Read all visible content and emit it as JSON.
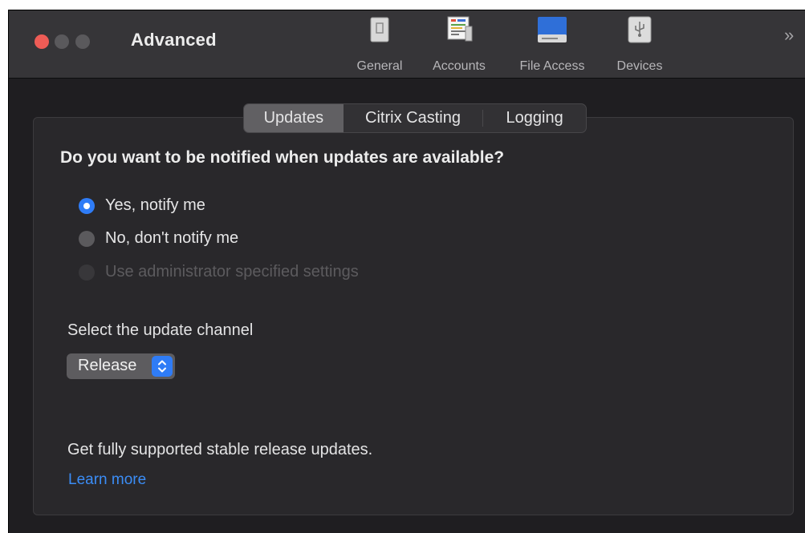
{
  "window": {
    "title": "Advanced",
    "overflow_glyph": "»"
  },
  "toolbar": {
    "items": [
      {
        "label": "General",
        "icon": "general-icon"
      },
      {
        "label": "Accounts",
        "icon": "accounts-icon"
      },
      {
        "label": "File Access",
        "icon": "file-access-icon"
      },
      {
        "label": "Devices",
        "icon": "devices-icon"
      }
    ]
  },
  "tabs": [
    {
      "label": "Updates",
      "selected": true
    },
    {
      "label": "Citrix Casting",
      "selected": false
    },
    {
      "label": "Logging",
      "selected": false
    }
  ],
  "updates": {
    "question": "Do you want to be notified when updates are available?",
    "options": [
      {
        "label": "Yes, notify me",
        "selected": true,
        "enabled": true
      },
      {
        "label": "No, don't notify me",
        "selected": false,
        "enabled": true
      },
      {
        "label": "Use administrator specified settings",
        "selected": false,
        "enabled": false
      }
    ],
    "channel_label": "Select the update channel",
    "channel_value": "Release",
    "description": "Get fully supported stable release updates.",
    "learn_more": "Learn more"
  },
  "colors": {
    "accent": "#2f7cf6",
    "link": "#3b8df6",
    "close": "#ee5c56",
    "background": "#1f1e21"
  }
}
